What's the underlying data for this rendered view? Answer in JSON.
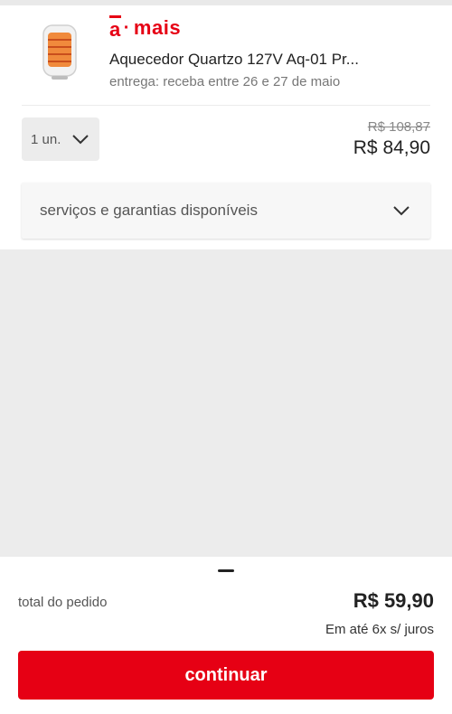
{
  "product": {
    "brand": {
      "letter": "a",
      "separator": "·",
      "word": "mais"
    },
    "title": "Aquecedor Quartzo 127V Aq-01 Pr...",
    "delivery": "entrega: receba entre 26 e 27 de maio",
    "quantity": "1 un.",
    "old_price": "R$ 108,87",
    "price": "R$ 84,90"
  },
  "services": {
    "label": "serviços e garantias disponíveis"
  },
  "summary": {
    "total_label": "total do pedido",
    "total_value": "R$ 59,90",
    "installments": "Em até 6x s/ juros",
    "continue_label": "continuar"
  },
  "colors": {
    "brand_red": "#e60014"
  }
}
